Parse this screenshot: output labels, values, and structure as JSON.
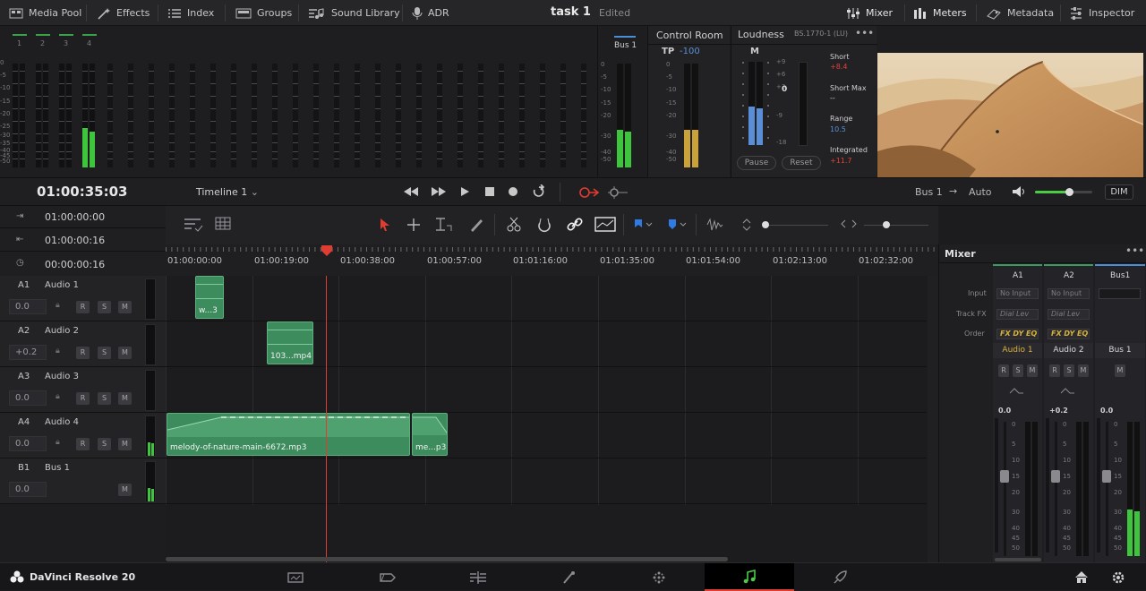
{
  "topbar": {
    "left": [
      {
        "label": "Media Pool",
        "icon": "media-pool-icon"
      },
      {
        "label": "Effects",
        "icon": "effects-icon"
      },
      {
        "label": "Index",
        "icon": "index-icon"
      },
      {
        "label": "Groups",
        "icon": "groups-icon"
      },
      {
        "label": "Sound Library",
        "icon": "sound-library-icon"
      },
      {
        "label": "ADR",
        "icon": "microphone-icon"
      }
    ],
    "project_title": "task 1",
    "status": "Edited",
    "right": [
      {
        "label": "Mixer",
        "icon": "mixer-icon"
      },
      {
        "label": "Meters",
        "icon": "meters-icon"
      },
      {
        "label": "Metadata",
        "icon": "metadata-icon"
      },
      {
        "label": "Inspector",
        "icon": "inspector-icon"
      }
    ]
  },
  "meters": {
    "channels": [
      "1",
      "2",
      "3",
      "4"
    ],
    "scale": [
      "0",
      "-5",
      "-10",
      "-15",
      "-20",
      "-25",
      "-30",
      "-35",
      "-40",
      "-45",
      "-50"
    ],
    "bus_label": "Bus 1",
    "control_room": {
      "title": "Control Room",
      "tp_label": "TP",
      "tp_value": "-100"
    },
    "loudness": {
      "title": "Loudness",
      "standard": "BS.1770-1 (LU)",
      "m_label": "M",
      "right_scale": [
        "+9",
        "+6",
        "+3",
        "0",
        "-3",
        "-6",
        "-9",
        "-12",
        "-15",
        "-18"
      ],
      "short_label": "Short",
      "short_value": "+8.4",
      "short_max_label": "Short Max",
      "short_max_value": "--",
      "range_label": "Range",
      "range_value": "10.5",
      "integrated_label": "Integrated",
      "integrated_value": "+11.7",
      "pause_label": "Pause",
      "reset_label": "Reset",
      "zero_mark": "0"
    }
  },
  "transport": {
    "timecode": "01:00:35:03",
    "timeline_name": "Timeline 1",
    "output": "Bus 1",
    "auto": "Auto",
    "dim": "DIM",
    "volume_level": 0.6
  },
  "timeline_header": {
    "rows": [
      {
        "icon": "in-point-icon",
        "value": "01:00:00:00"
      },
      {
        "icon": "out-point-icon",
        "value": "01:00:00:16"
      },
      {
        "icon": "duration-clock-icon",
        "value": "00:00:00:16"
      }
    ]
  },
  "ruler": {
    "labels": [
      "01:00:00:00",
      "01:00:19:00",
      "01:00:38:00",
      "01:00:57:00",
      "01:01:16:00",
      "01:01:35:00",
      "01:01:54:00",
      "01:02:13:00",
      "01:02:32:00"
    ]
  },
  "tracks": [
    {
      "id": "A1",
      "name": "Audio 1",
      "volume": "0.0",
      "r": "R",
      "s": "S",
      "m": "M"
    },
    {
      "id": "A2",
      "name": "Audio 2",
      "volume": "+0.2",
      "r": "R",
      "s": "S",
      "m": "M"
    },
    {
      "id": "A3",
      "name": "Audio 3",
      "volume": "0.0",
      "r": "R",
      "s": "S",
      "m": "M"
    },
    {
      "id": "A4",
      "name": "Audio 4",
      "volume": "0.0",
      "r": "R",
      "s": "S",
      "m": "M"
    },
    {
      "id": "B1",
      "name": "Bus 1",
      "volume": "0.0",
      "m": "M"
    }
  ],
  "clips": [
    {
      "label": "w...3"
    },
    {
      "label": "103...mp4"
    },
    {
      "label": "melody-of-nature-main-6672.mp3"
    },
    {
      "label": "me...p3"
    }
  ],
  "mixer": {
    "title": "Mixer",
    "row_labels": {
      "input": "Input",
      "track_fx": "Track FX",
      "order": "Order"
    },
    "columns": [
      {
        "header": "A1",
        "input": "No Input",
        "fx": "Dial Lev",
        "order": "FX DY EQ",
        "name": "Audio 1",
        "gain": "0.0",
        "r": "R",
        "s": "S",
        "m": "M"
      },
      {
        "header": "A2",
        "input": "No Input",
        "fx": "Dial Lev",
        "order": "FX DY EQ",
        "name": "Audio 2",
        "gain": "+0.2",
        "r": "R",
        "s": "S",
        "m": "M"
      },
      {
        "header": "Bus1",
        "input": "",
        "fx": "",
        "order": "",
        "name": "Bus 1",
        "gain": "0.0",
        "m": "M"
      }
    ],
    "fader_scale": [
      "0",
      "5",
      "10",
      "15",
      "20",
      "30",
      "40",
      "45",
      "50"
    ]
  },
  "bottombar": {
    "app": "DaVinci Resolve 20",
    "pages": [
      "media-page-icon",
      "cut-page-icon",
      "edit-page-icon",
      "fusion-page-icon",
      "color-page-icon",
      "fairlight-page-icon",
      "deliver-page-icon"
    ],
    "active_page": "fairlight-page-icon"
  },
  "colors": {
    "accent_green": "#4ccc45",
    "playhead": "#e03c31",
    "clip": "#3c8c5e",
    "active_red": "#e03c31",
    "loudness_red": "#e0413a",
    "loudness_blue": "#5a8ed6"
  }
}
